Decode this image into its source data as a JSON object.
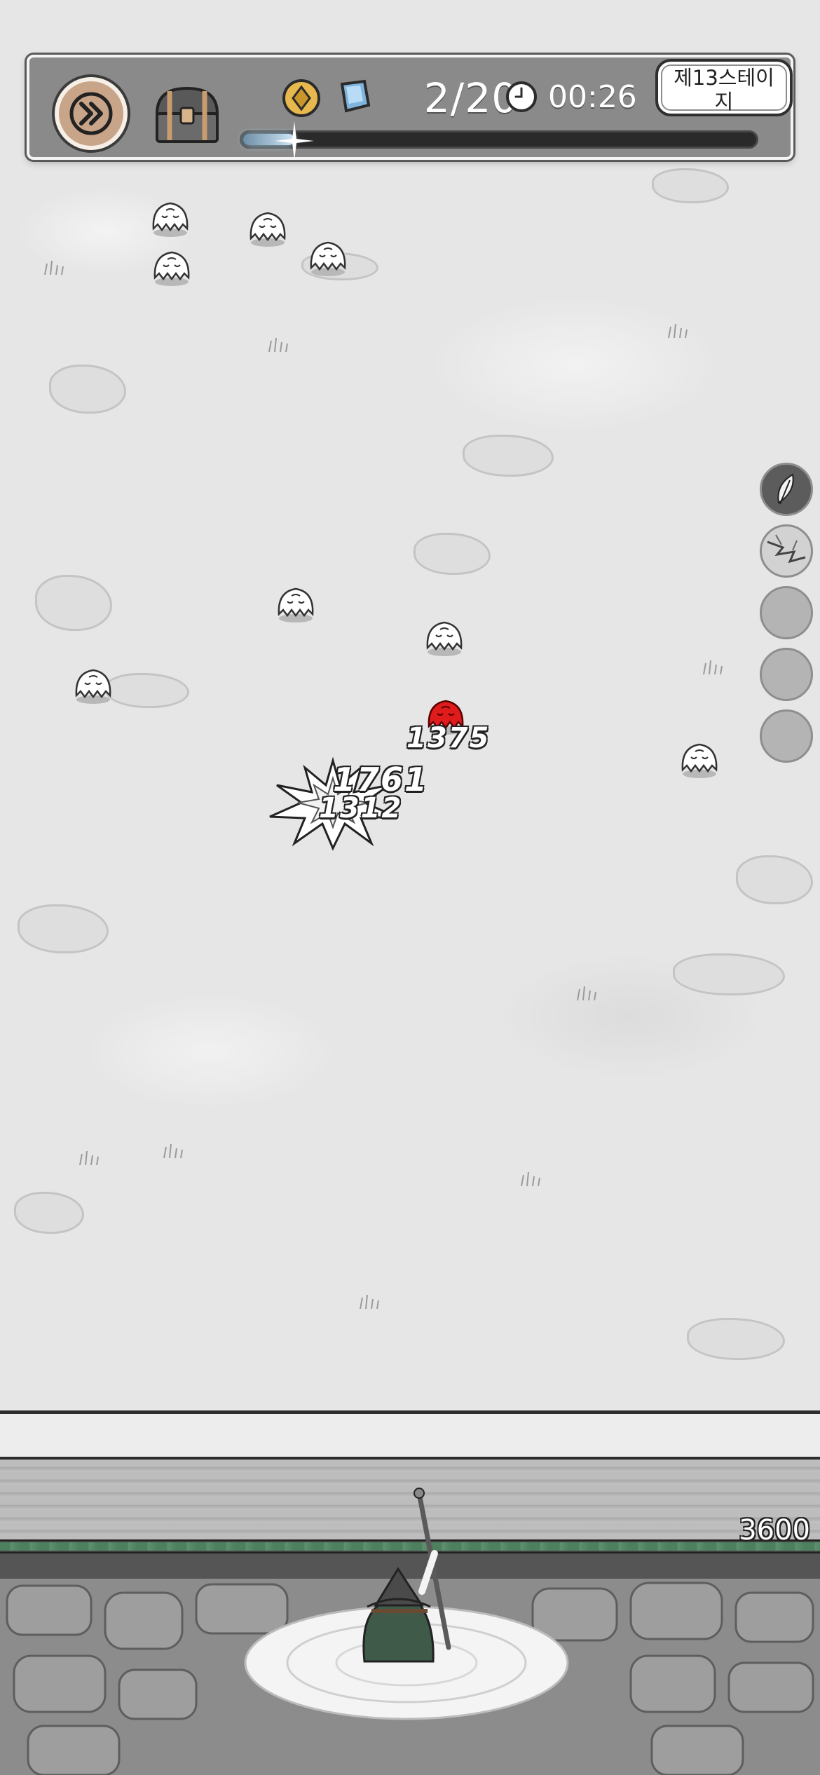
{
  "hud": {
    "wave_counter": "2/20",
    "timer": "00:26",
    "stage_label": "제13스테이지",
    "wave_progress": 0.1,
    "icons": {
      "speed": "fast-forward-icon",
      "chest": "treasure-chest-icon",
      "coin": "gold-coin-icon",
      "gem": "blue-gem-icon",
      "clock": "clock-icon"
    }
  },
  "damage_numbers": [
    "1375",
    "1761",
    "1312"
  ],
  "skills": {
    "slots": [
      {
        "state": "equipped",
        "icon": "feather-skill-icon"
      },
      {
        "state": "equipped",
        "icon": "lightning-skill-icon"
      },
      {
        "state": "empty"
      },
      {
        "state": "empty"
      },
      {
        "state": "empty"
      }
    ]
  },
  "wall": {
    "hp_value": "3600",
    "hp_fraction": 1.0
  },
  "colors": {
    "hp_bar": "#4e7f5e",
    "hit_enemy": "#e01b1b",
    "progress_glow": "#cfe6f6"
  }
}
